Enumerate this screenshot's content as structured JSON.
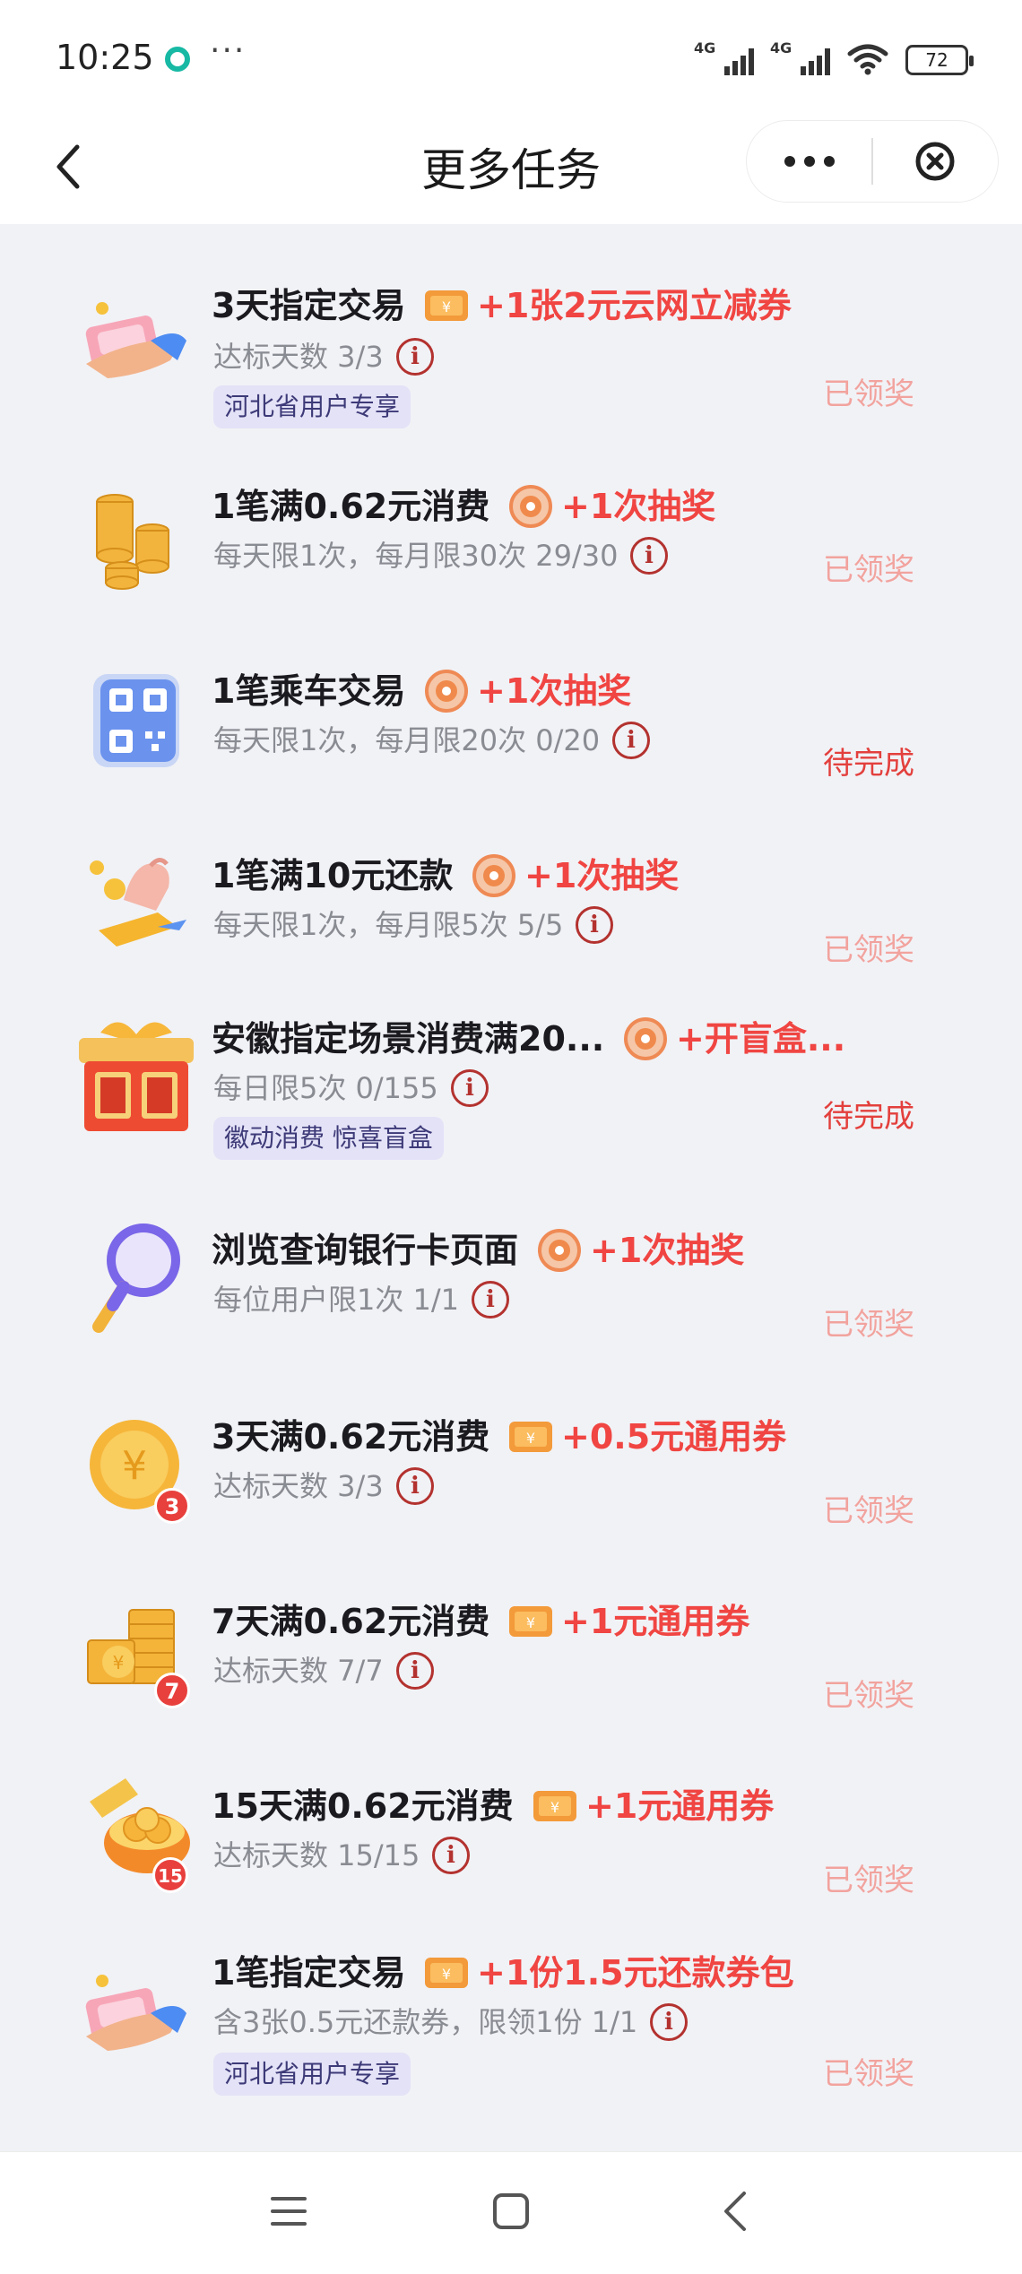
{
  "status_bar": {
    "time": "10:25",
    "more": "···",
    "network_1": "4G",
    "network_2": "4G",
    "battery": "72"
  },
  "nav": {
    "title": "更多任务"
  },
  "colors": {
    "reward_red": "#f04542",
    "status_done": "#f2a39e",
    "status_todo": "#e3403d",
    "tag_bg": "#e4e2f7"
  },
  "tasks": [
    {
      "icon": "hand-cash-icon",
      "title": "3天指定交易",
      "reward_icon": "coupon-icon",
      "reward": "+1张2元云网立减券",
      "desc": "达标天数 3/3",
      "tag": "河北省用户专享",
      "status": "已领奖"
    },
    {
      "icon": "gold-coins-icon",
      "title": "1笔满0.62元消费",
      "reward_icon": "lottery-disc-icon",
      "reward": "+1次抽奖",
      "desc": "每天限1次，每月限30次 29/30",
      "status": "已领奖"
    },
    {
      "icon": "qr-code-icon",
      "title": "1笔乘车交易",
      "reward_icon": "lottery-disc-icon",
      "reward": "+1次抽奖",
      "desc": "每天限1次，每月限20次 0/20",
      "status": "待完成"
    },
    {
      "icon": "hand-coin-icon",
      "title": "1笔满10元还款",
      "reward_icon": "lottery-disc-icon",
      "reward": "+1次抽奖",
      "desc": "每天限1次，每月限5次 5/5",
      "status": "已领奖"
    },
    {
      "icon": "gift-box-icon",
      "title": "安徽指定场景消费满20...",
      "reward_icon": "lottery-disc-icon",
      "reward": "+开盲盒...",
      "desc": "每日限5次 0/155",
      "tag": "徽动消费 惊喜盲盒",
      "status": "待完成"
    },
    {
      "icon": "magnifier-icon",
      "title": "浏览查询银行卡页面",
      "reward_icon": "lottery-disc-icon",
      "reward": "+1次抽奖",
      "desc": "每位用户限1次 1/1",
      "status": "已领奖"
    },
    {
      "icon": "yuan-coin-icon",
      "badge": "3",
      "title": "3天满0.62元消费",
      "reward_icon": "coupon-icon",
      "reward": "+0.5元通用券",
      "desc": "达标天数 3/3",
      "status": "已领奖"
    },
    {
      "icon": "coin-stack-icon",
      "badge": "7",
      "title": "7天满0.62元消费",
      "reward_icon": "coupon-icon",
      "reward": "+1元通用券",
      "desc": "达标天数 7/7",
      "status": "已领奖"
    },
    {
      "icon": "treasure-box-icon",
      "badge": "15",
      "title": "15天满0.62元消费",
      "reward_icon": "coupon-icon",
      "reward": "+1元通用券",
      "desc": "达标天数 15/15",
      "status": "已领奖"
    },
    {
      "icon": "hand-cash-icon",
      "title": "1笔指定交易",
      "reward_icon": "coupon-icon",
      "reward": "+1份1.5元还款券包",
      "desc": "含3张0.5元还款券，限领1份 1/1",
      "tag": "河北省用户专享",
      "status": "已领奖"
    }
  ]
}
